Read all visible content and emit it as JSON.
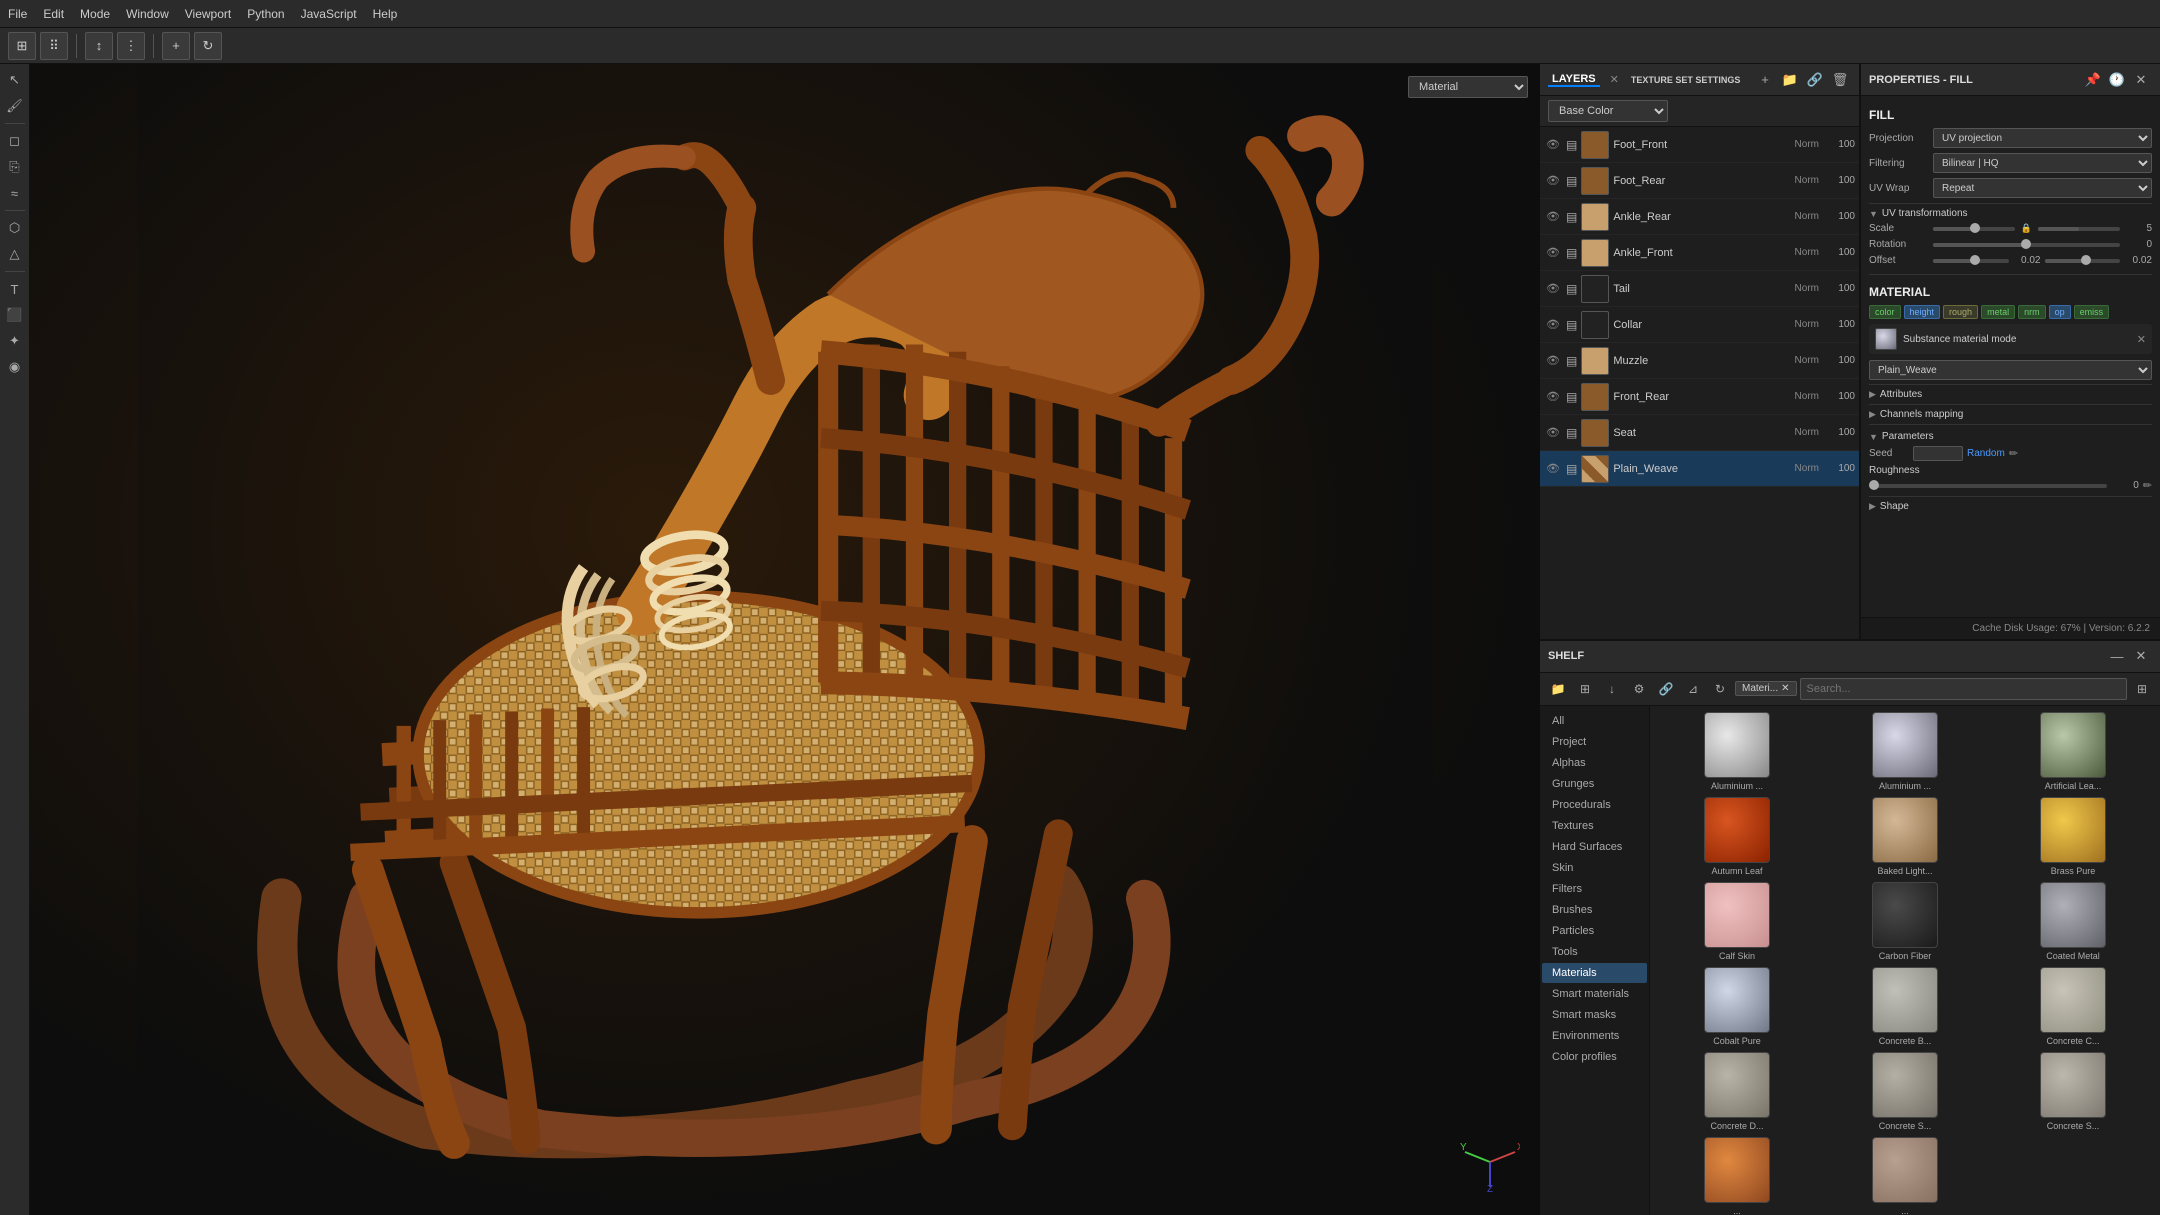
{
  "menuBar": {
    "items": [
      "File",
      "Edit",
      "Mode",
      "Window",
      "Viewport",
      "Python",
      "JavaScript",
      "Help"
    ]
  },
  "toolbar": {
    "buttons": [
      "grid-icon",
      "dots-icon",
      "layers-icon",
      "filter-icon",
      "add-icon",
      "refresh-icon"
    ]
  },
  "viewport": {
    "materialDropdown": "Material",
    "axes": "XYZ"
  },
  "layersPanel": {
    "tab1": "LAYERS",
    "tab2": "TEXTURE SET SETTINGS",
    "baseColor": "Base Color",
    "layers": [
      {
        "name": "Foot_Front",
        "mode": "Norm",
        "opacity": "100",
        "thumbClass": "layer-thumb-brown"
      },
      {
        "name": "Foot_Rear",
        "mode": "Norm",
        "opacity": "100",
        "thumbClass": "layer-thumb-brown"
      },
      {
        "name": "Ankle_Rear",
        "mode": "Norm",
        "opacity": "100",
        "thumbClass": "layer-thumb-tan"
      },
      {
        "name": "Ankle_Front",
        "mode": "Norm",
        "opacity": "100",
        "thumbClass": "layer-thumb-tan"
      },
      {
        "name": "Tail",
        "mode": "Norm",
        "opacity": "100",
        "thumbClass": "layer-thumb-dark"
      },
      {
        "name": "Collar",
        "mode": "Norm",
        "opacity": "100",
        "thumbClass": "layer-thumb-dark"
      },
      {
        "name": "Muzzle",
        "mode": "Norm",
        "opacity": "100",
        "thumbClass": "layer-thumb-tan"
      },
      {
        "name": "Front_Rear",
        "mode": "Norm",
        "opacity": "100",
        "thumbClass": "layer-thumb-brown"
      },
      {
        "name": "Seat",
        "mode": "Norm",
        "opacity": "100",
        "thumbClass": "layer-thumb-brown"
      },
      {
        "name": "Plain_Weave",
        "mode": "Norm",
        "opacity": "100",
        "thumbClass": "layer-thumb-weave",
        "selected": true
      }
    ]
  },
  "shelfPanel": {
    "title": "SHELF",
    "filterTag": "Materi...",
    "searchPlaceholder": "Search...",
    "categories": [
      {
        "name": "All",
        "active": false
      },
      {
        "name": "Project",
        "active": false
      },
      {
        "name": "Alphas",
        "active": false
      },
      {
        "name": "Grunges",
        "active": false
      },
      {
        "name": "Procedurals",
        "active": false
      },
      {
        "name": "Textures",
        "active": false
      },
      {
        "name": "Hard Surfaces",
        "active": false
      },
      {
        "name": "Skin",
        "active": false
      },
      {
        "name": "Filters",
        "active": false
      },
      {
        "name": "Brushes",
        "active": false
      },
      {
        "name": "Particles",
        "active": false
      },
      {
        "name": "Tools",
        "active": false
      },
      {
        "name": "Materials",
        "active": true
      },
      {
        "name": "Smart materials",
        "active": false
      },
      {
        "name": "Smart masks",
        "active": false
      },
      {
        "name": "Environments",
        "active": false
      },
      {
        "name": "Color profiles",
        "active": false
      }
    ],
    "materials": [
      {
        "name": "Aluminium ...",
        "class": "mat-aluminum-a"
      },
      {
        "name": "Aluminium ...",
        "class": "mat-aluminum-b"
      },
      {
        "name": "Artificial Lea...",
        "class": "mat-artificial"
      },
      {
        "name": "Autumn Leaf",
        "class": "mat-autumn"
      },
      {
        "name": "Baked Light...",
        "class": "mat-baked"
      },
      {
        "name": "Brass Pure",
        "class": "mat-brass"
      },
      {
        "name": "Calf Skin",
        "class": "mat-calf"
      },
      {
        "name": "Carbon Fiber",
        "class": "mat-carbon"
      },
      {
        "name": "Coated Metal",
        "class": "mat-coated"
      },
      {
        "name": "Cobalt Pure",
        "class": "mat-cobalt"
      },
      {
        "name": "Concrete B...",
        "class": "mat-concrete-b"
      },
      {
        "name": "Concrete C...",
        "class": "mat-concrete-c"
      },
      {
        "name": "Concrete D...",
        "class": "mat-concrete-d"
      },
      {
        "name": "Concrete S...",
        "class": "mat-concrete-s"
      },
      {
        "name": "Concrete S...",
        "class": "mat-concrete-s2"
      },
      {
        "name": "...",
        "class": "mat-unknown-a"
      },
      {
        "name": "...",
        "class": "mat-unknown-b"
      }
    ]
  },
  "propertiesPanel": {
    "title": "PROPERTIES - FILL",
    "fillSection": {
      "label": "FILL",
      "projectionLabel": "Projection",
      "projectionValue": "UV projection",
      "filteringLabel": "Filtering",
      "filteringValue": "Bilinear | HQ",
      "uvWrapLabel": "UV Wrap",
      "uvWrapValue": "Repeat"
    },
    "uvTransformations": {
      "title": "UV transformations",
      "scaleLabel": "Scale",
      "scaleValue": "5",
      "rotationLabel": "Rotation",
      "rotationValue": "0",
      "offsetLabel": "Offset",
      "offsetX": "0.02",
      "offsetY": "0.02"
    },
    "material": {
      "title": "MATERIAL",
      "tags": [
        {
          "name": "color",
          "class": "mat-tag"
        },
        {
          "name": "height",
          "class": "mat-tag active-tag"
        },
        {
          "name": "rough",
          "class": "mat-tag roughness-tag"
        },
        {
          "name": "metal",
          "class": "mat-tag"
        },
        {
          "name": "nrm",
          "class": "mat-tag"
        },
        {
          "name": "op",
          "class": "mat-tag active-tag"
        },
        {
          "name": "emiss",
          "class": "mat-tag"
        }
      ],
      "substanceName": "Substance material mode",
      "substanceMode": "Plain_Weave"
    },
    "parameters": {
      "title": "Parameters",
      "seedLabel": "Seed",
      "seedValue": "",
      "seedRandomLabel": "Seed Random",
      "randomLabel": "Random",
      "roughnessLabel": "Roughness",
      "roughnessValue": "0"
    },
    "shape": {
      "title": "Shape"
    },
    "attributes": "Attributes",
    "channelsMapping": "Channels mapping"
  },
  "statusBar": {
    "text": "Cache Disk Usage: 67% | Version: 6.2.2"
  }
}
